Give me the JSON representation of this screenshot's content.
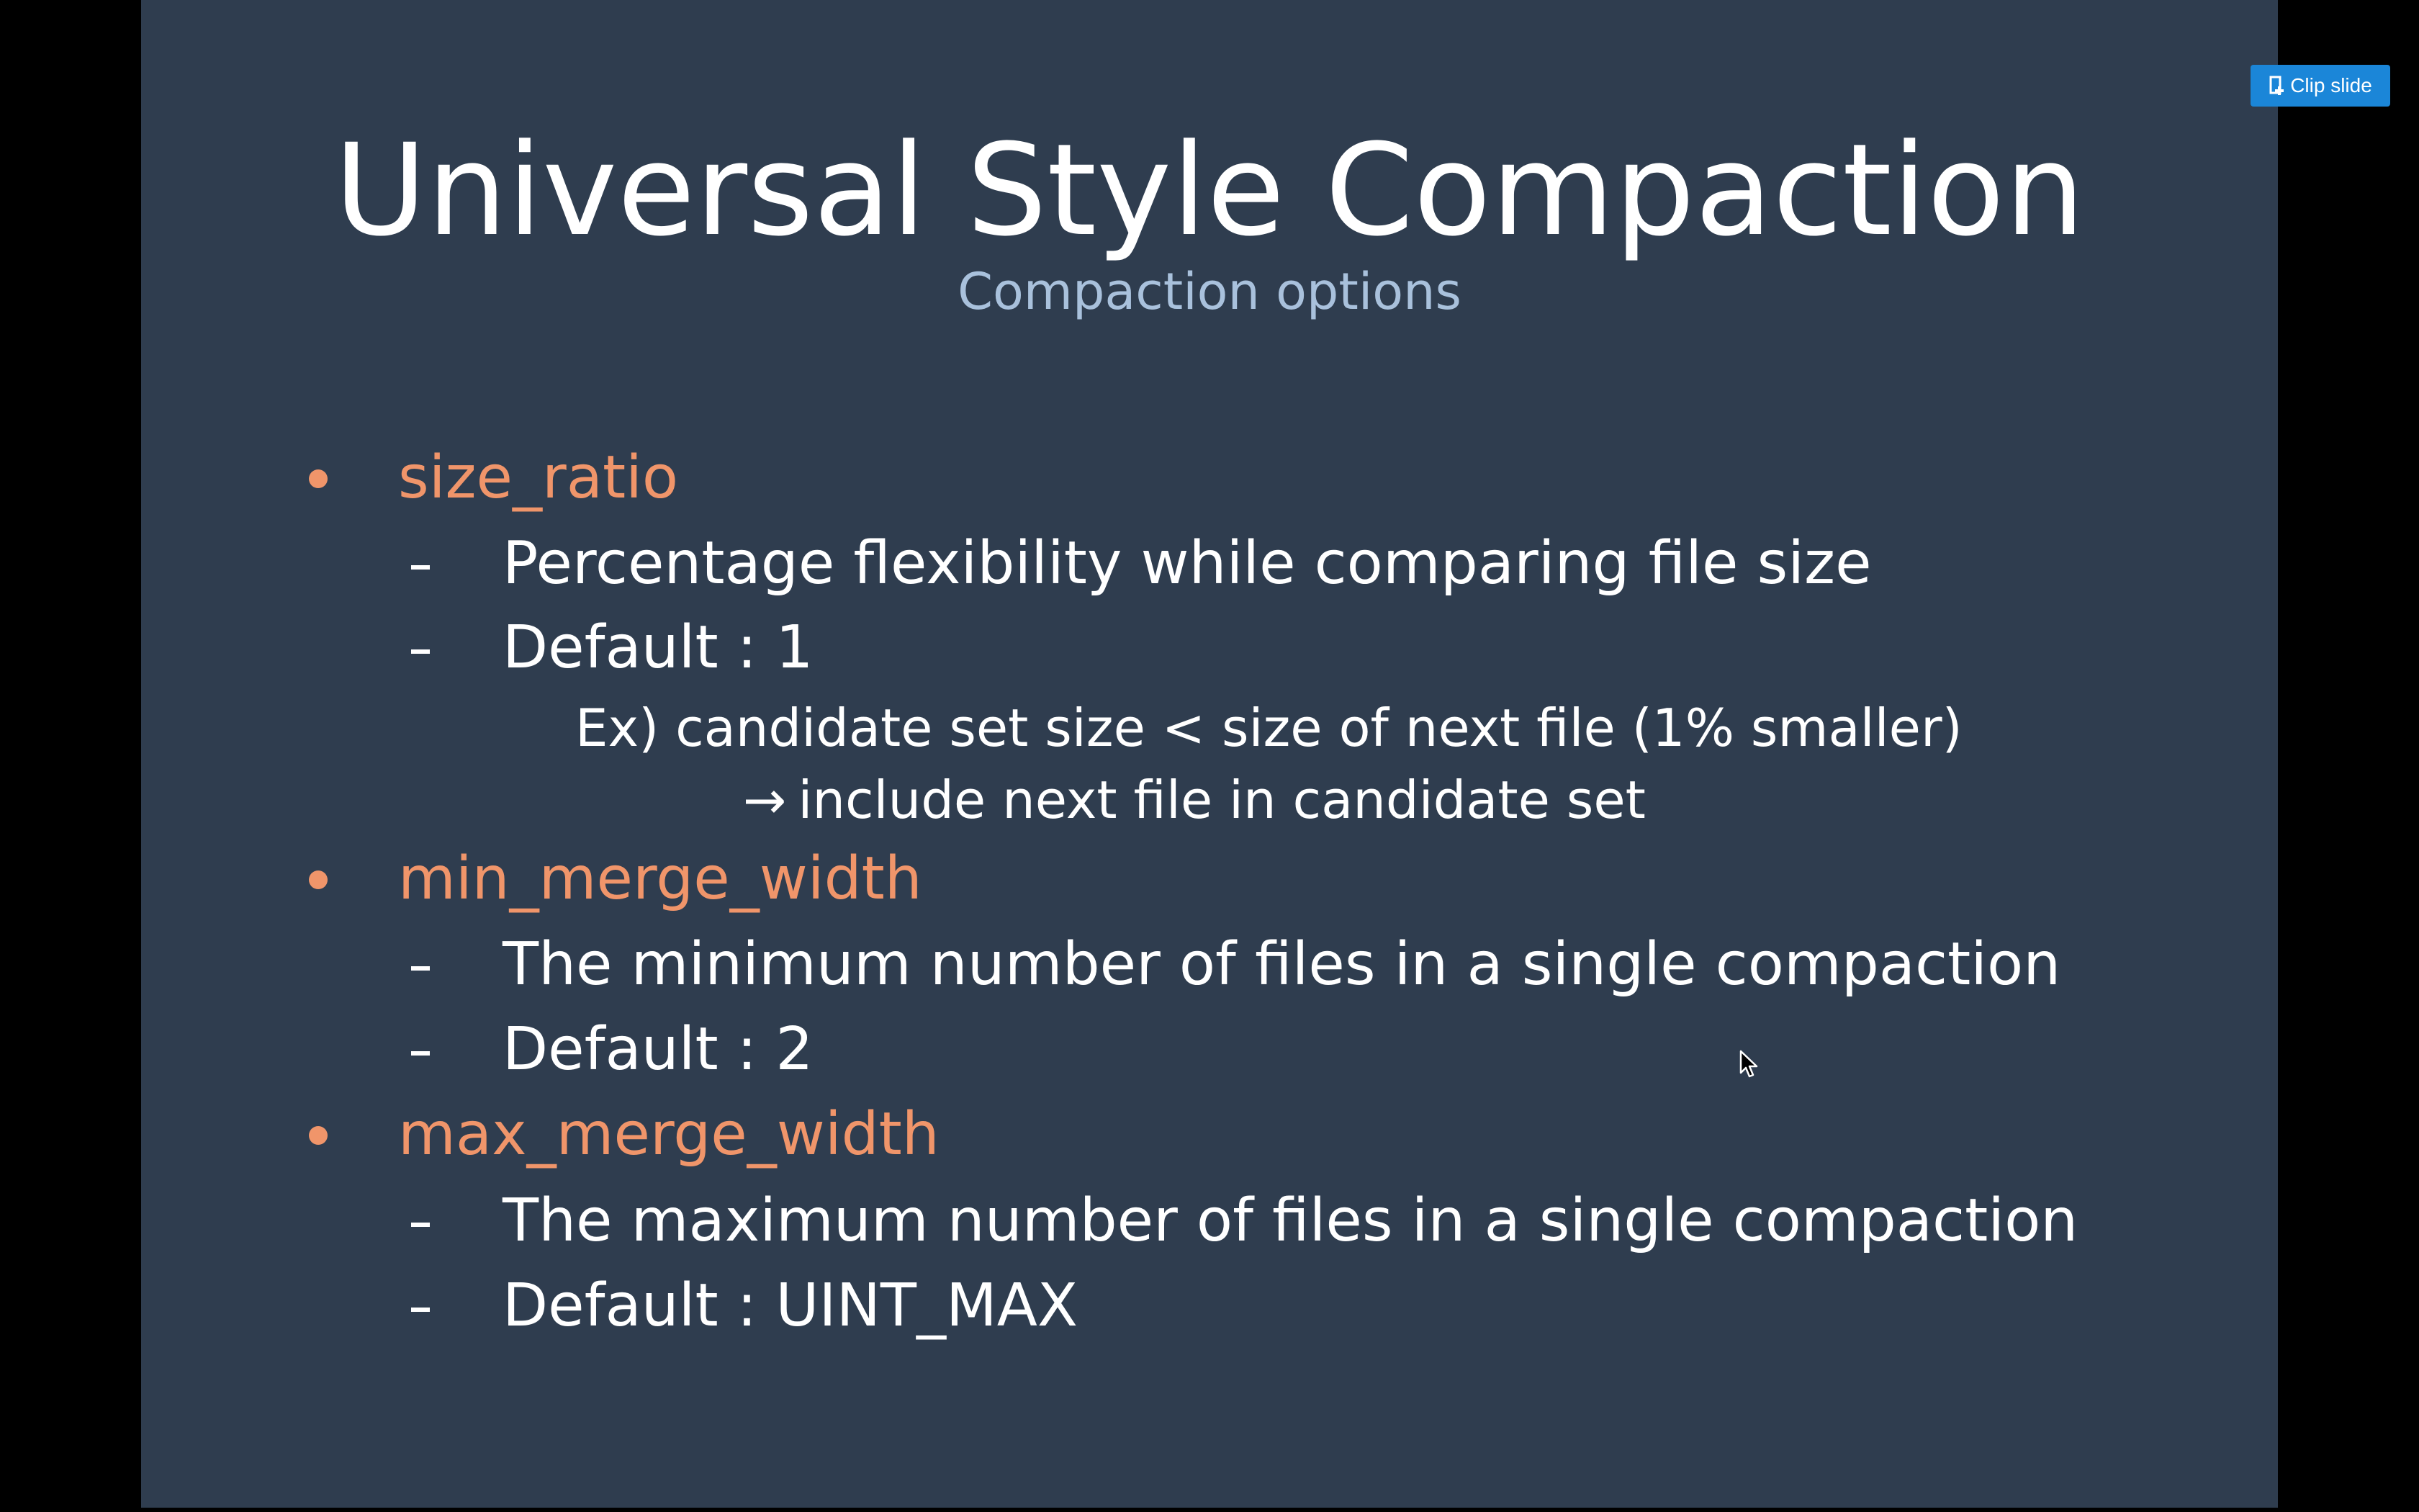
{
  "slide": {
    "title": "Universal Style Compaction",
    "subtitle": "Compaction options",
    "options": [
      {
        "name": "size_ratio",
        "details": [
          "Percentage flexibility while comparing file size",
          "Default : 1"
        ],
        "notes": [
          "Ex) candidate set size < size of next file (1% smaller)",
          "include next file in candidate set"
        ]
      },
      {
        "name": "min_merge_width",
        "details": [
          "The minimum number of files in a single compaction",
          "Default : 2"
        ]
      },
      {
        "name": "max_merge_width",
        "details": [
          "The maximum number of files in a single compaction",
          "Default : UINT_MAX"
        ]
      }
    ],
    "arrow_glyph": "→"
  },
  "toolbar": {
    "clip_label": "Clip slide"
  },
  "colors": {
    "slide_background": "#2f3d4f",
    "bullet_accent": "#f0956a",
    "subtitle": "#a9c1dc",
    "clip_button": "#1b86d8"
  },
  "icons": {
    "clip": "clip-slide-icon",
    "cursor": "mouse-cursor-icon"
  }
}
